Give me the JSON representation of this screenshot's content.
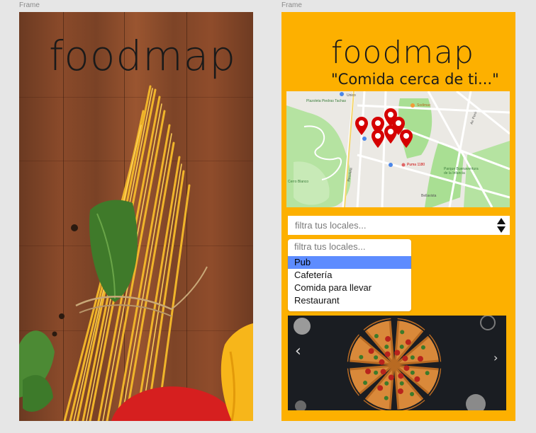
{
  "canvas": {
    "frame_labels": [
      "Frame",
      "Frame"
    ]
  },
  "splash": {
    "logo": "foodmap"
  },
  "home": {
    "logo": "foodmap",
    "tagline": "\"Comida cerca de ti...\"",
    "map": {
      "labels": [
        "Plazoleta Piedras Tachas",
        "Unico",
        "Sodimac",
        "Parque Buenaventura de la Infancia",
        "Puma 1180",
        "Cerro Blanco",
        "Bellavista",
        "Recoleta",
        "Av. Perú"
      ]
    },
    "filter": {
      "placeholder": "filtra tus locales..."
    },
    "dropdown": {
      "placeholder": "filtra tus locales...",
      "options": [
        "Pub",
        "Cafetería",
        "Comida para llevar",
        "Restaurant"
      ],
      "selected": "Pub"
    },
    "carousel": {
      "prev": "‹",
      "next": "›"
    }
  },
  "colors": {
    "accent": "#fdb000",
    "selected": "#5d8cff",
    "marker": "#d50000"
  }
}
